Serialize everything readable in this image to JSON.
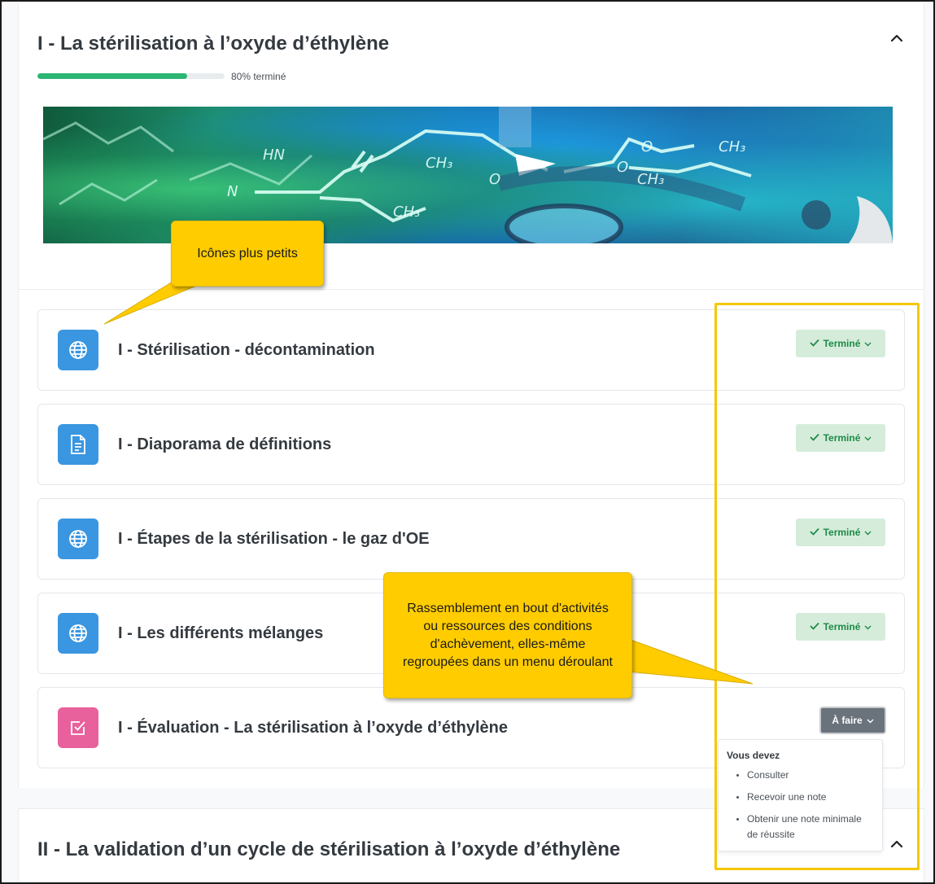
{
  "section1": {
    "title": "I - La stérilisation à l’oxyde d’éthylène",
    "progress_percent": 80,
    "progress_label": "80% terminé"
  },
  "banner": {
    "formula_labels": [
      "HN",
      "N",
      "CH₃",
      "O",
      "O",
      "CH₃",
      "O",
      "CH₃",
      "CH₃"
    ]
  },
  "activities": [
    {
      "title": "I - Stérilisation - décontamination",
      "icon": "globe-icon",
      "icon_color": "#3a96e0",
      "status": "Terminé"
    },
    {
      "title": "I - Diaporama de définitions",
      "icon": "document-icon",
      "icon_color": "#3a96e0",
      "status": "Terminé"
    },
    {
      "title": "I - Étapes de la stérilisation - le gaz d'OE",
      "icon": "globe-icon",
      "icon_color": "#3a96e0",
      "status": "Terminé"
    },
    {
      "title": "I - Les différents mélanges",
      "icon": "globe-icon",
      "icon_color": "#3a96e0",
      "status": "Terminé"
    },
    {
      "title": "I - Évaluation - La stérilisation à l’oxyde d’éthylène",
      "icon": "quiz-checkbox-icon",
      "icon_color": "#e8609c",
      "status": "À faire"
    }
  ],
  "completion_dropdown": {
    "heading": "Vous devez",
    "items": [
      "Consulter",
      "Recevoir une note",
      "Obtenir une note minimale de réussite"
    ]
  },
  "section2": {
    "title": "II - La validation d’un cycle de stérilisation à l’oxyde d’éthylène"
  },
  "annotations": {
    "callout_icons": "Icônes plus petits",
    "callout_completion": "Rassemblement en bout d'activités ou ressources des conditions d'achèvement, elles-même regroupées dans un menu déroulant"
  },
  "colors": {
    "progress": "#2bb673",
    "done_badge_bg": "#d5ecdb",
    "done_badge_text": "#1e8a46",
    "todo_badge_bg": "#6a737b",
    "callout": "#ffcc00",
    "highlight_box": "#f4c800"
  }
}
